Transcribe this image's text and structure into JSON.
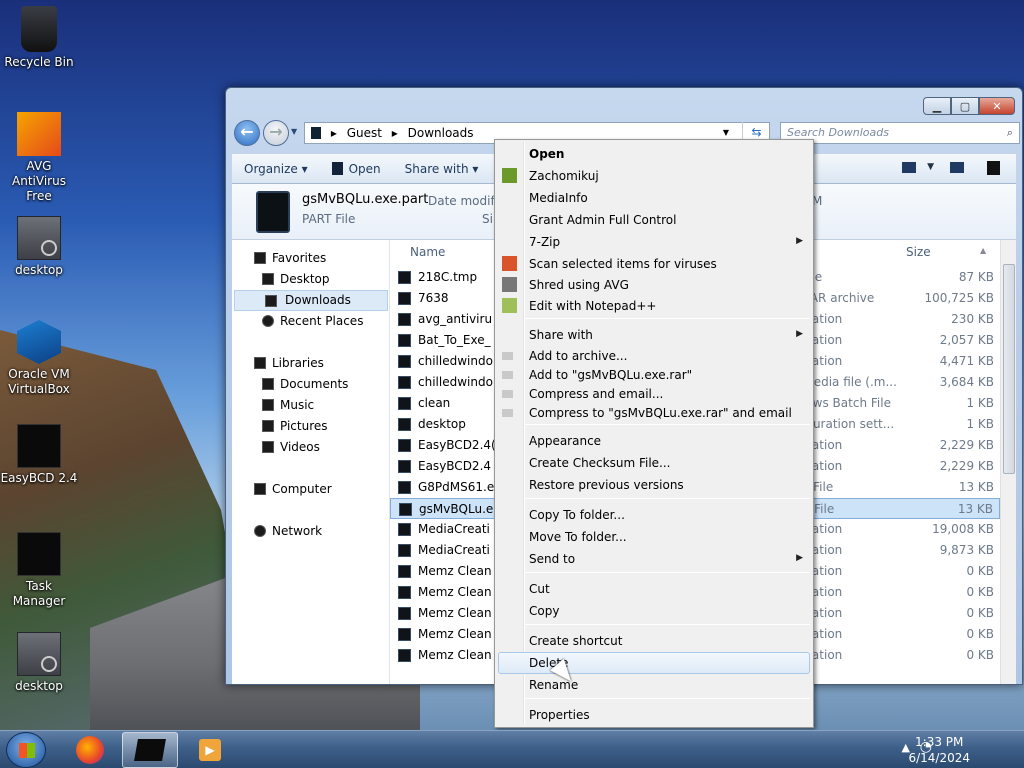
{
  "desktop": {
    "icons": [
      {
        "label": "Recycle Bin",
        "icon": "recycle-bin-icon"
      },
      {
        "label": "AVG AntiVirus Free",
        "icon": "avg-icon"
      },
      {
        "label": "desktop",
        "icon": "file-icon"
      },
      {
        "label": "Oracle VM VirtualBox",
        "icon": "virtualbox-icon"
      },
      {
        "label": "EasyBCD 2.4",
        "icon": "easybcd-icon"
      },
      {
        "label": "Task Manager",
        "icon": "task-manager-icon"
      },
      {
        "label": "desktop",
        "icon": "file-icon"
      }
    ]
  },
  "explorer": {
    "breadcrumb": [
      "Guest",
      "Downloads"
    ],
    "search_placeholder": "Search Downloads",
    "toolbar": {
      "organize": "Organize",
      "open": "Open",
      "share_with": "Share with"
    },
    "details": {
      "filename": "gsMvBQLu.exe.part",
      "date_label": "Date modifie",
      "type": "PART File",
      "size_label": "Si",
      "extra": "M"
    },
    "nav": {
      "favorites": "Favorites",
      "desktop": "Desktop",
      "downloads": "Downloads",
      "recent": "Recent Places",
      "libraries": "Libraries",
      "documents": "Documents",
      "music": "Music",
      "pictures": "Pictures",
      "videos": "Videos",
      "computer": "Computer",
      "network": "Network"
    },
    "columns": {
      "name": "Name",
      "type": "e",
      "size": "Size"
    },
    "files": [
      {
        "name": "218C.tmp",
        "type": "File",
        "size": "87 KB"
      },
      {
        "name": "7638",
        "type": "RAR archive",
        "size": "100,725 KB"
      },
      {
        "name": "avg_antiviru",
        "type": "ication",
        "size": "230 KB"
      },
      {
        "name": "Bat_To_Exe_",
        "type": "ication",
        "size": "2,057 KB"
      },
      {
        "name": "chilledwindo",
        "type": "ication",
        "size": "4,471 KB"
      },
      {
        "name": "chilledwindo",
        "type": "media file (.m...",
        "size": "3,684 KB"
      },
      {
        "name": "clean",
        "type": "lows Batch File",
        "size": "1 KB"
      },
      {
        "name": "desktop",
        "type": "iguration sett...",
        "size": "1 KB"
      },
      {
        "name": "EasyBCD2.4(",
        "type": "ication",
        "size": "2,229 KB"
      },
      {
        "name": "EasyBCD2.4",
        "type": "ication",
        "size": "2,229 KB"
      },
      {
        "name": "G8PdMS61.e",
        "type": "T File",
        "size": "13 KB"
      },
      {
        "name": "gsMvBQLu.e",
        "type": "T File",
        "size": "13 KB"
      },
      {
        "name": "MediaCreati",
        "type": "ication",
        "size": "19,008 KB"
      },
      {
        "name": "MediaCreati",
        "type": "ication",
        "size": "9,873 KB"
      },
      {
        "name": "Memz Clean",
        "type": "ication",
        "size": "0 KB"
      },
      {
        "name": "Memz Clean",
        "type": "ication",
        "size": "0 KB"
      },
      {
        "name": "Memz Clean",
        "type": "ication",
        "size": "0 KB"
      },
      {
        "name": "Memz Clean",
        "type": "ication",
        "size": "0 KB"
      },
      {
        "name": "Memz Clean",
        "type": "ication",
        "size": "0 KB"
      }
    ]
  },
  "context_menu": {
    "items": [
      {
        "label": "Open",
        "bold": true
      },
      {
        "label": "Zachomikuj"
      },
      {
        "label": "MediaInfo"
      },
      {
        "label": "Grant Admin Full Control"
      },
      {
        "label": "7-Zip",
        "submenu": true
      },
      {
        "label": "Scan selected items for viruses"
      },
      {
        "label": "Shred using AVG"
      },
      {
        "label": "Edit with Notepad++"
      },
      {
        "label": "Share with",
        "submenu": true
      },
      {
        "label": "Add to archive..."
      },
      {
        "label": "Add to \"gsMvBQLu.exe.rar\""
      },
      {
        "label": "Compress and email..."
      },
      {
        "label": "Compress to \"gsMvBQLu.exe.rar\" and email"
      },
      {
        "label": "Appearance"
      },
      {
        "label": "Create Checksum File..."
      },
      {
        "label": "Restore previous versions"
      },
      {
        "label": "Copy To folder..."
      },
      {
        "label": "Move To folder..."
      },
      {
        "label": "Send to",
        "submenu": true
      },
      {
        "label": "Cut"
      },
      {
        "label": "Copy"
      },
      {
        "label": "Create shortcut"
      },
      {
        "label": "Delete",
        "highlighted": true
      },
      {
        "label": "Rename"
      },
      {
        "label": "Properties"
      }
    ]
  },
  "taskbar": {
    "time": "1:33 PM",
    "date": "6/14/2024"
  }
}
